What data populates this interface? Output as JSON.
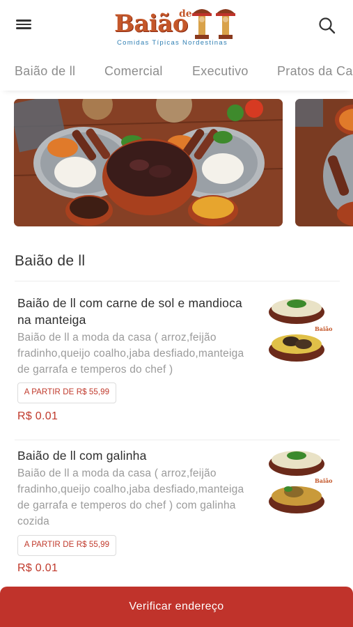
{
  "header": {
    "logo_word": "Baião",
    "logo_de": "de",
    "logo_tagline": "Comidas Típicas Nordestinas",
    "menu_icon": "hamburger-menu-icon",
    "search_icon": "search-icon"
  },
  "tabs": [
    {
      "label": "Baião de ll"
    },
    {
      "label": "Comercial"
    },
    {
      "label": "Executivo"
    },
    {
      "label": "Pratos da Casa"
    }
  ],
  "section": {
    "title": "Baião de ll"
  },
  "products": [
    {
      "name_line1": "Baião de ll com carne de sol e mandioca",
      "name_line2": "na manteiga",
      "desc_line1": "Baião de ll a moda da casa ( arroz,feijão",
      "desc_line2": "fradinho,queijo coalho,jaba desfiado,manteiga",
      "desc_line3": "de garrafa e temperos do chef )",
      "badge": "A PARTIR DE R$ 55,99",
      "price": "R$ 0.01"
    },
    {
      "name_line1": "Baião de ll com galinha",
      "desc_line1": "Baião de ll a moda da casa ( arroz,feijão",
      "desc_line2": "fradinho,queijo coalho,jaba desfiado,manteiga",
      "desc_line3": "de garrafa e temperos do chef ) com galinha",
      "desc_line4": "cozida",
      "badge": "A PARTIR DE R$ 55,99",
      "price": "R$ 0.01"
    }
  ],
  "cta": {
    "label": "Verificar endereço"
  },
  "colors": {
    "accent": "#c0332b",
    "price": "#c0392b",
    "logo": "#c4572a",
    "tagline": "#2f7fb3"
  }
}
